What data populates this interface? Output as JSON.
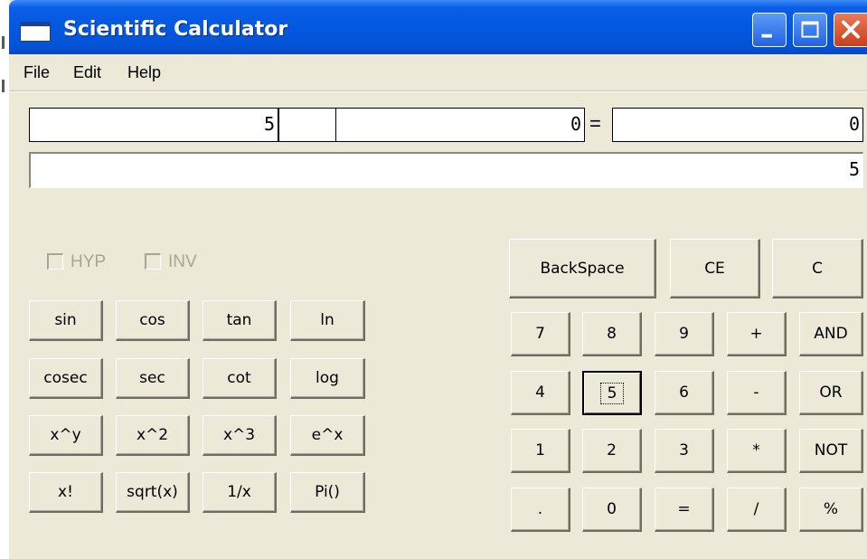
{
  "window": {
    "title": "Scientific Calculator"
  },
  "titlebar_buttons": {
    "minimize_icon": "minimize-icon",
    "maximize_icon": "maximize-icon",
    "close_icon": "close-icon"
  },
  "menu": {
    "file": "File",
    "edit": "Edit",
    "help": "Help"
  },
  "display": {
    "operand1": "5",
    "operator": "",
    "operand2": "0",
    "equals": "=",
    "result": "0",
    "main": "5"
  },
  "checkboxes": {
    "hyp": "HYP",
    "inv": "INV"
  },
  "sci_buttons": {
    "sin": "sin",
    "cos": "cos",
    "tan": "tan",
    "ln": "ln",
    "cosec": "cosec",
    "sec": "sec",
    "cot": "cot",
    "log": "log",
    "xpowy": "x^y",
    "xsq": "x^2",
    "xcube": "x^3",
    "epowx": "e^x",
    "fact": "x!",
    "sqrt": "sqrt(x)",
    "recip": "1/x",
    "pi": "Pi()"
  },
  "edit_buttons": {
    "backspace": "BackSpace",
    "ce": "CE",
    "c": "C"
  },
  "keypad": {
    "n7": "7",
    "n8": "8",
    "n9": "9",
    "plus": "+",
    "and": "AND",
    "n4": "4",
    "n5": "5",
    "n6": "6",
    "minus": "-",
    "or": "OR",
    "n1": "1",
    "n2": "2",
    "n3": "3",
    "mul": "*",
    "not": "NOT",
    "dot": ".",
    "n0": "0",
    "eq": "=",
    "div": "/",
    "pct": "%"
  },
  "colors": {
    "face": "#ece9d8",
    "titlebar": "#0458e0",
    "close": "#c8401a",
    "disabled_text": "#a7a597"
  }
}
